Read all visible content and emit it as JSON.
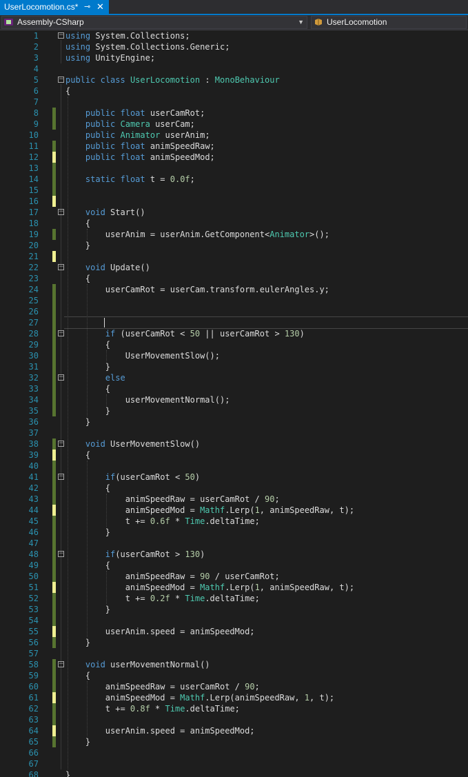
{
  "tab": {
    "title": "UserLocomotion.cs*",
    "pin_icon": "pin-icon",
    "close_icon": "close-icon"
  },
  "nav": {
    "project": "Assembly-CSharp",
    "class": "UserLocomotion",
    "project_icon": "csharp-project-icon",
    "class_icon": "class-icon"
  },
  "colors": {
    "accent": "#007acc",
    "keyword": "#569cd6",
    "type": "#4ec9b0",
    "number": "#b5cea8",
    "text": "#dcdcdc",
    "line_number": "#2b91af",
    "saved_change": "#577430",
    "unsaved_change": "#efef91"
  },
  "lines": [
    {
      "n": "1",
      "fold": "minus",
      "chg": "",
      "tokens": [
        [
          "kw",
          "using"
        ],
        [
          "t",
          " System.Collections;"
        ]
      ]
    },
    {
      "n": "2",
      "fold": "",
      "chg": "",
      "tokens": [
        [
          "kw",
          "using"
        ],
        [
          "t",
          " System.Collections.Generic;"
        ]
      ]
    },
    {
      "n": "3",
      "fold": "",
      "chg": "",
      "tokens": [
        [
          "kw",
          "using"
        ],
        [
          "t",
          " UnityEngine;"
        ]
      ]
    },
    {
      "n": "4",
      "fold": "",
      "chg": "",
      "tokens": []
    },
    {
      "n": "5",
      "fold": "minus",
      "chg": "",
      "tokens": [
        [
          "kw",
          "public"
        ],
        [
          "t",
          " "
        ],
        [
          "kw",
          "class"
        ],
        [
          "t",
          " "
        ],
        [
          "ty",
          "UserLocomotion"
        ],
        [
          "t",
          " : "
        ],
        [
          "ty",
          "MonoBehaviour"
        ]
      ]
    },
    {
      "n": "6",
      "fold": "",
      "chg": "",
      "tokens": [
        [
          "t",
          "{"
        ]
      ]
    },
    {
      "n": "7",
      "fold": "",
      "chg": "",
      "tokens": []
    },
    {
      "n": "8",
      "fold": "",
      "chg": "saved",
      "tokens": [
        [
          "t",
          "    "
        ],
        [
          "kw",
          "public"
        ],
        [
          "t",
          " "
        ],
        [
          "kw",
          "float"
        ],
        [
          "t",
          " userCamRot;"
        ]
      ]
    },
    {
      "n": "9",
      "fold": "",
      "chg": "saved",
      "tokens": [
        [
          "t",
          "    "
        ],
        [
          "kw",
          "public"
        ],
        [
          "t",
          " "
        ],
        [
          "ty",
          "Camera"
        ],
        [
          "t",
          " userCam;"
        ]
      ]
    },
    {
      "n": "10",
      "fold": "",
      "chg": "",
      "tokens": [
        [
          "t",
          "    "
        ],
        [
          "kw",
          "public"
        ],
        [
          "t",
          " "
        ],
        [
          "ty",
          "Animator"
        ],
        [
          "t",
          " userAnim;"
        ]
      ]
    },
    {
      "n": "11",
      "fold": "",
      "chg": "saved",
      "tokens": [
        [
          "t",
          "    "
        ],
        [
          "kw",
          "public"
        ],
        [
          "t",
          " "
        ],
        [
          "kw",
          "float"
        ],
        [
          "t",
          " animSpeedRaw;"
        ]
      ]
    },
    {
      "n": "12",
      "fold": "",
      "chg": "unsaved",
      "tokens": [
        [
          "t",
          "    "
        ],
        [
          "kw",
          "public"
        ],
        [
          "t",
          " "
        ],
        [
          "kw",
          "float"
        ],
        [
          "t",
          " animSpeedMod;"
        ]
      ]
    },
    {
      "n": "13",
      "fold": "",
      "chg": "saved",
      "tokens": []
    },
    {
      "n": "14",
      "fold": "",
      "chg": "saved",
      "tokens": [
        [
          "t",
          "    "
        ],
        [
          "kw",
          "static"
        ],
        [
          "t",
          " "
        ],
        [
          "kw",
          "float"
        ],
        [
          "t",
          " t = "
        ],
        [
          "nu",
          "0.0f"
        ],
        [
          "t",
          ";"
        ]
      ]
    },
    {
      "n": "15",
      "fold": "",
      "chg": "saved",
      "tokens": []
    },
    {
      "n": "16",
      "fold": "",
      "chg": "unsaved",
      "tokens": []
    },
    {
      "n": "17",
      "fold": "minus",
      "chg": "",
      "tokens": [
        [
          "t",
          "    "
        ],
        [
          "kw",
          "void"
        ],
        [
          "t",
          " Start()"
        ]
      ]
    },
    {
      "n": "18",
      "fold": "",
      "chg": "",
      "tokens": [
        [
          "t",
          "    {"
        ]
      ]
    },
    {
      "n": "19",
      "fold": "",
      "chg": "saved",
      "tokens": [
        [
          "t",
          "        userAnim = userAnim.GetComponent<"
        ],
        [
          "ty",
          "Animator"
        ],
        [
          "t",
          ">();"
        ]
      ]
    },
    {
      "n": "20",
      "fold": "",
      "chg": "",
      "tokens": [
        [
          "t",
          "    }"
        ]
      ]
    },
    {
      "n": "21",
      "fold": "",
      "chg": "unsaved",
      "tokens": []
    },
    {
      "n": "22",
      "fold": "minus",
      "chg": "",
      "tokens": [
        [
          "t",
          "    "
        ],
        [
          "kw",
          "void"
        ],
        [
          "t",
          " Update()"
        ]
      ]
    },
    {
      "n": "23",
      "fold": "",
      "chg": "",
      "tokens": [
        [
          "t",
          "    {"
        ]
      ]
    },
    {
      "n": "24",
      "fold": "",
      "chg": "saved",
      "tokens": [
        [
          "t",
          "        userCamRot = userCam.transform.eulerAngles.y;"
        ]
      ]
    },
    {
      "n": "25",
      "fold": "",
      "chg": "saved",
      "tokens": []
    },
    {
      "n": "26",
      "fold": "",
      "chg": "saved",
      "tokens": []
    },
    {
      "n": "27",
      "fold": "",
      "chg": "saved",
      "tokens": []
    },
    {
      "n": "28",
      "fold": "minus",
      "chg": "saved",
      "tokens": [
        [
          "t",
          "        "
        ],
        [
          "kw",
          "if"
        ],
        [
          "t",
          " (userCamRot < "
        ],
        [
          "nu",
          "50"
        ],
        [
          "t",
          " || userCamRot > "
        ],
        [
          "nu",
          "130"
        ],
        [
          "t",
          ")"
        ]
      ]
    },
    {
      "n": "29",
      "fold": "",
      "chg": "saved",
      "tokens": [
        [
          "t",
          "        {"
        ]
      ]
    },
    {
      "n": "30",
      "fold": "",
      "chg": "saved",
      "tokens": [
        [
          "t",
          "            UserMovementSlow();"
        ]
      ]
    },
    {
      "n": "31",
      "fold": "",
      "chg": "saved",
      "tokens": [
        [
          "t",
          "        }"
        ]
      ]
    },
    {
      "n": "32",
      "fold": "minus",
      "chg": "saved",
      "tokens": [
        [
          "t",
          "        "
        ],
        [
          "kw",
          "else"
        ]
      ]
    },
    {
      "n": "33",
      "fold": "",
      "chg": "saved",
      "tokens": [
        [
          "t",
          "        {"
        ]
      ]
    },
    {
      "n": "34",
      "fold": "",
      "chg": "saved",
      "tokens": [
        [
          "t",
          "            userMovementNormal();"
        ]
      ]
    },
    {
      "n": "35",
      "fold": "",
      "chg": "saved",
      "tokens": [
        [
          "t",
          "        }"
        ]
      ]
    },
    {
      "n": "36",
      "fold": "",
      "chg": "",
      "tokens": [
        [
          "t",
          "    }"
        ]
      ]
    },
    {
      "n": "37",
      "fold": "",
      "chg": "",
      "tokens": []
    },
    {
      "n": "38",
      "fold": "minus",
      "chg": "saved",
      "tokens": [
        [
          "t",
          "    "
        ],
        [
          "kw",
          "void"
        ],
        [
          "t",
          " UserMovementSlow()"
        ]
      ]
    },
    {
      "n": "39",
      "fold": "",
      "chg": "unsaved",
      "tokens": [
        [
          "t",
          "    {"
        ]
      ]
    },
    {
      "n": "40",
      "fold": "",
      "chg": "saved",
      "tokens": []
    },
    {
      "n": "41",
      "fold": "minus",
      "chg": "saved",
      "tokens": [
        [
          "t",
          "        "
        ],
        [
          "kw",
          "if"
        ],
        [
          "t",
          "(userCamRot < "
        ],
        [
          "nu",
          "50"
        ],
        [
          "t",
          ")"
        ]
      ]
    },
    {
      "n": "42",
      "fold": "",
      "chg": "saved",
      "tokens": [
        [
          "t",
          "        {"
        ]
      ]
    },
    {
      "n": "43",
      "fold": "",
      "chg": "saved",
      "tokens": [
        [
          "t",
          "            animSpeedRaw = userCamRot / "
        ],
        [
          "nu",
          "90"
        ],
        [
          "t",
          ";"
        ]
      ]
    },
    {
      "n": "44",
      "fold": "",
      "chg": "unsaved",
      "tokens": [
        [
          "t",
          "            animSpeedMod = "
        ],
        [
          "ty",
          "Mathf"
        ],
        [
          "t",
          ".Lerp("
        ],
        [
          "nu",
          "1"
        ],
        [
          "t",
          ", animSpeedRaw, t);"
        ]
      ]
    },
    {
      "n": "45",
      "fold": "",
      "chg": "saved",
      "tokens": [
        [
          "t",
          "            t += "
        ],
        [
          "nu",
          "0.6f"
        ],
        [
          "t",
          " * "
        ],
        [
          "ty",
          "Time"
        ],
        [
          "t",
          ".deltaTime;"
        ]
      ]
    },
    {
      "n": "46",
      "fold": "",
      "chg": "saved",
      "tokens": [
        [
          "t",
          "        }"
        ]
      ]
    },
    {
      "n": "47",
      "fold": "",
      "chg": "saved",
      "tokens": []
    },
    {
      "n": "48",
      "fold": "minus",
      "chg": "saved",
      "tokens": [
        [
          "t",
          "        "
        ],
        [
          "kw",
          "if"
        ],
        [
          "t",
          "(userCamRot > "
        ],
        [
          "nu",
          "130"
        ],
        [
          "t",
          ")"
        ]
      ]
    },
    {
      "n": "49",
      "fold": "",
      "chg": "saved",
      "tokens": [
        [
          "t",
          "        {"
        ]
      ]
    },
    {
      "n": "50",
      "fold": "",
      "chg": "saved",
      "tokens": [
        [
          "t",
          "            animSpeedRaw = "
        ],
        [
          "nu",
          "90"
        ],
        [
          "t",
          " / userCamRot;"
        ]
      ]
    },
    {
      "n": "51",
      "fold": "",
      "chg": "unsaved",
      "tokens": [
        [
          "t",
          "            animSpeedMod = "
        ],
        [
          "ty",
          "Mathf"
        ],
        [
          "t",
          ".Lerp("
        ],
        [
          "nu",
          "1"
        ],
        [
          "t",
          ", animSpeedRaw, t);"
        ]
      ]
    },
    {
      "n": "52",
      "fold": "",
      "chg": "saved",
      "tokens": [
        [
          "t",
          "            t += "
        ],
        [
          "nu",
          "0.2f"
        ],
        [
          "t",
          " * "
        ],
        [
          "ty",
          "Time"
        ],
        [
          "t",
          ".deltaTime;"
        ]
      ]
    },
    {
      "n": "53",
      "fold": "",
      "chg": "saved",
      "tokens": [
        [
          "t",
          "        }"
        ]
      ]
    },
    {
      "n": "54",
      "fold": "",
      "chg": "saved",
      "tokens": []
    },
    {
      "n": "55",
      "fold": "",
      "chg": "unsaved",
      "tokens": [
        [
          "t",
          "        userAnim.speed = animSpeedMod;"
        ]
      ]
    },
    {
      "n": "56",
      "fold": "",
      "chg": "saved",
      "tokens": [
        [
          "t",
          "    }"
        ]
      ]
    },
    {
      "n": "57",
      "fold": "",
      "chg": "",
      "tokens": []
    },
    {
      "n": "58",
      "fold": "minus",
      "chg": "saved",
      "tokens": [
        [
          "t",
          "    "
        ],
        [
          "kw",
          "void"
        ],
        [
          "t",
          " userMovementNormal()"
        ]
      ]
    },
    {
      "n": "59",
      "fold": "",
      "chg": "saved",
      "tokens": [
        [
          "t",
          "    {"
        ]
      ]
    },
    {
      "n": "60",
      "fold": "",
      "chg": "saved",
      "tokens": [
        [
          "t",
          "        animSpeedRaw = userCamRot / "
        ],
        [
          "nu",
          "90"
        ],
        [
          "t",
          ";"
        ]
      ]
    },
    {
      "n": "61",
      "fold": "",
      "chg": "unsaved",
      "tokens": [
        [
          "t",
          "        animSpeedMod = "
        ],
        [
          "ty",
          "Mathf"
        ],
        [
          "t",
          ".Lerp(animSpeedRaw, "
        ],
        [
          "nu",
          "1"
        ],
        [
          "t",
          ", t);"
        ]
      ]
    },
    {
      "n": "62",
      "fold": "",
      "chg": "saved",
      "tokens": [
        [
          "t",
          "        t += "
        ],
        [
          "nu",
          "0.8f"
        ],
        [
          "t",
          " * "
        ],
        [
          "ty",
          "Time"
        ],
        [
          "t",
          ".deltaTime;"
        ]
      ]
    },
    {
      "n": "63",
      "fold": "",
      "chg": "saved",
      "tokens": []
    },
    {
      "n": "64",
      "fold": "",
      "chg": "unsaved",
      "tokens": [
        [
          "t",
          "        userAnim.speed = animSpeedMod;"
        ]
      ]
    },
    {
      "n": "65",
      "fold": "",
      "chg": "saved",
      "tokens": [
        [
          "t",
          "    }"
        ]
      ]
    },
    {
      "n": "66",
      "fold": "",
      "chg": "",
      "tokens": []
    },
    {
      "n": "67",
      "fold": "",
      "chg": "",
      "tokens": []
    },
    {
      "n": "68",
      "fold": "",
      "chg": "",
      "tokens": [
        [
          "t",
          "}"
        ]
      ]
    }
  ],
  "cursor_line": "27"
}
